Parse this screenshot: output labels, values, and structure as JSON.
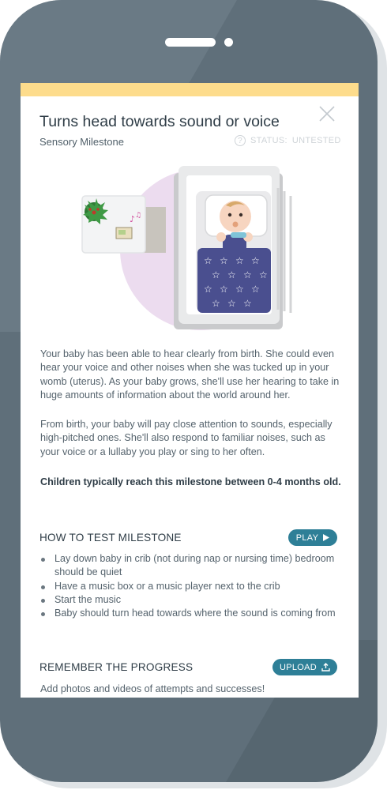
{
  "milestone": {
    "title": "Turns head towards sound or voice",
    "category": "Sensory Milestone",
    "status_label": "STATUS:",
    "status_value": "UNTESTED"
  },
  "description": {
    "paragraph1": "Your baby has been able to hear clearly from birth. She could even hear your voice and other noises when she was tucked up in your womb (uterus). As your baby grows, she'll use her hearing to take in huge amounts of information about the world around her.",
    "paragraph2": "From birth, your baby will pay close attention to sounds, especially high-pitched ones. She'll also respond to familiar noises, such as your voice or a lullaby you play or sing to her often.",
    "typical_age": "Children typically reach this milestone between 0-4 months old."
  },
  "how_to_test": {
    "heading": "HOW TO TEST MILESTONE",
    "play_label": "PLAY",
    "steps": [
      "Lay down baby in crib (not during nap or nursing time) bedroom should be quiet",
      "Have a music box or a music player next to the crib",
      "Start the music",
      "Baby should turn head towards where the sound is coming from"
    ]
  },
  "progress": {
    "heading": "REMEMBER THE PROGRESS",
    "upload_label": "UPLOAD",
    "hint": "Add photos and videos of attempts and successes!"
  },
  "colors": {
    "accent": "#2e7f97",
    "top_bar": "#fddc8c",
    "phone_body": "#5f6f7a",
    "blanket": "#4a4f8f",
    "circle": "#ecdcef"
  }
}
